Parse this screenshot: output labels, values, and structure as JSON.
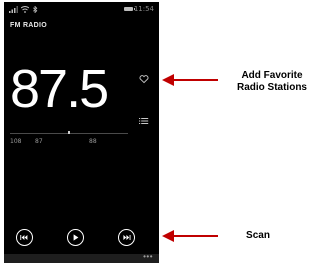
{
  "status_bar": {
    "time": "11:54",
    "icons": [
      "signal-icon",
      "wifi-icon",
      "bluetooth-icon",
      "battery-icon"
    ]
  },
  "app": {
    "title": "FM RADIO",
    "frequency": "87.5",
    "tuner_ticks": [
      "108",
      "87",
      "88"
    ],
    "more_menu": "•••"
  },
  "controls": {
    "icons": [
      "previous-icon",
      "play-icon",
      "next-icon"
    ]
  },
  "callouts": {
    "favorite_line1": "Add Favorite",
    "favorite_line2": "Radio Stations",
    "scan": "Scan"
  },
  "colors": {
    "screen_bg": "#000000",
    "arrow": "#c00000",
    "text": "#ffffff"
  }
}
